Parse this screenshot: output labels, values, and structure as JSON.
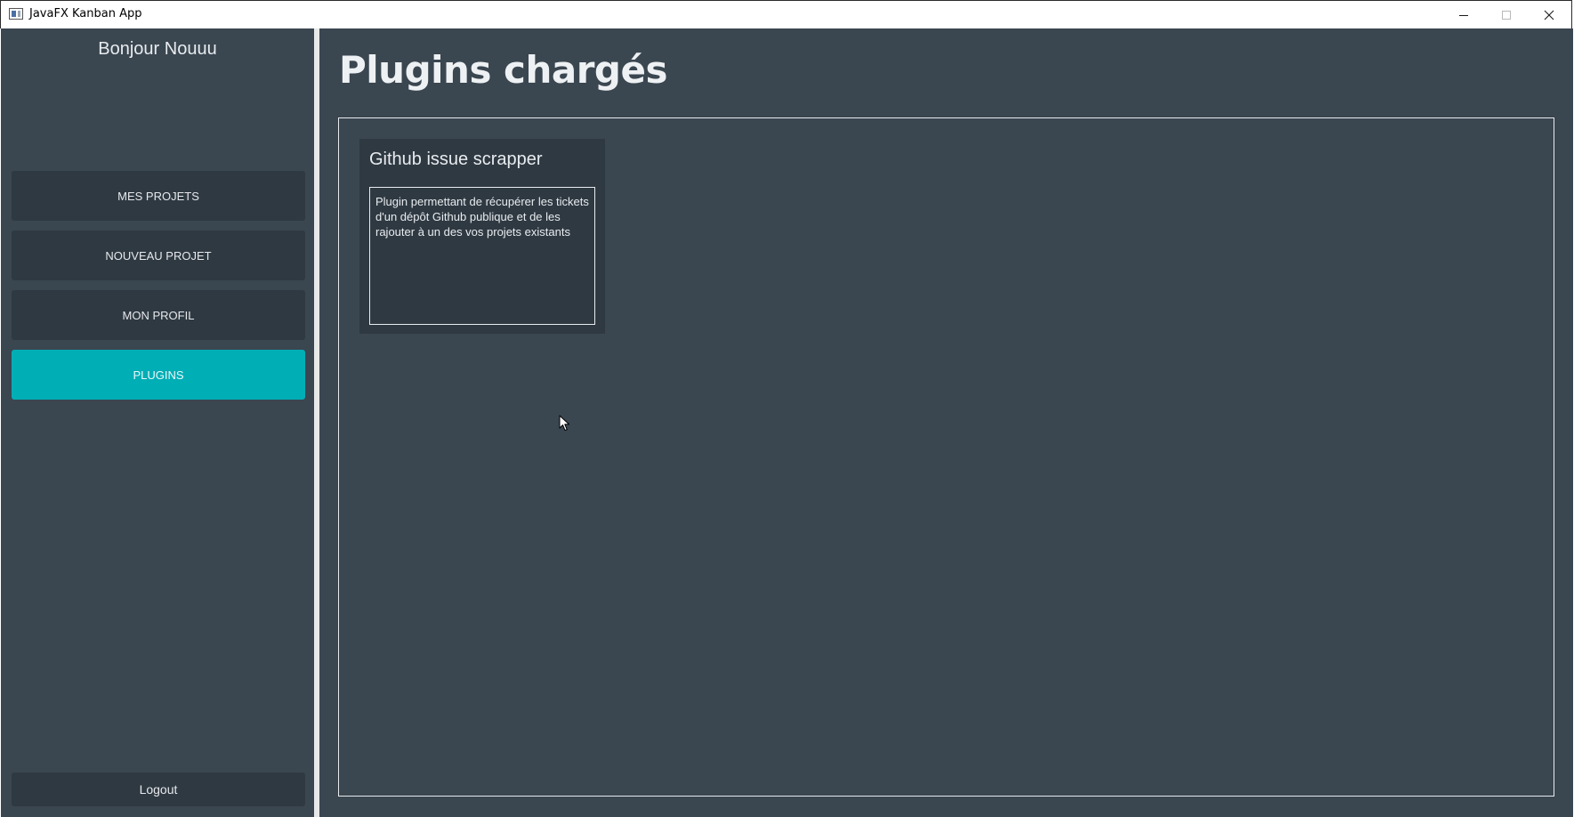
{
  "window": {
    "title": "JavaFX Kanban App",
    "controls": {
      "minimize_icon": "minimize-icon",
      "maximize_icon": "maximize-icon",
      "close_icon": "close-icon"
    }
  },
  "sidebar": {
    "greeting": "Bonjour Nouuu",
    "items": [
      {
        "label": "MES PROJETS",
        "active": false
      },
      {
        "label": "NOUVEAU PROJET",
        "active": false
      },
      {
        "label": "MON PROFIL",
        "active": false
      },
      {
        "label": "PLUGINS",
        "active": true
      }
    ],
    "logout_label": "Logout"
  },
  "main": {
    "title": "Plugins chargés",
    "plugins": [
      {
        "name": "Github issue scrapper",
        "description": "Plugin permettant de récupérer les tickets d'un dépôt Github publique et de les rajouter à un des vos projets existants"
      }
    ]
  },
  "colors": {
    "background": "#3a4650",
    "button": "#2f3942",
    "accent": "#00aeb6",
    "text": "#e8ecef"
  }
}
